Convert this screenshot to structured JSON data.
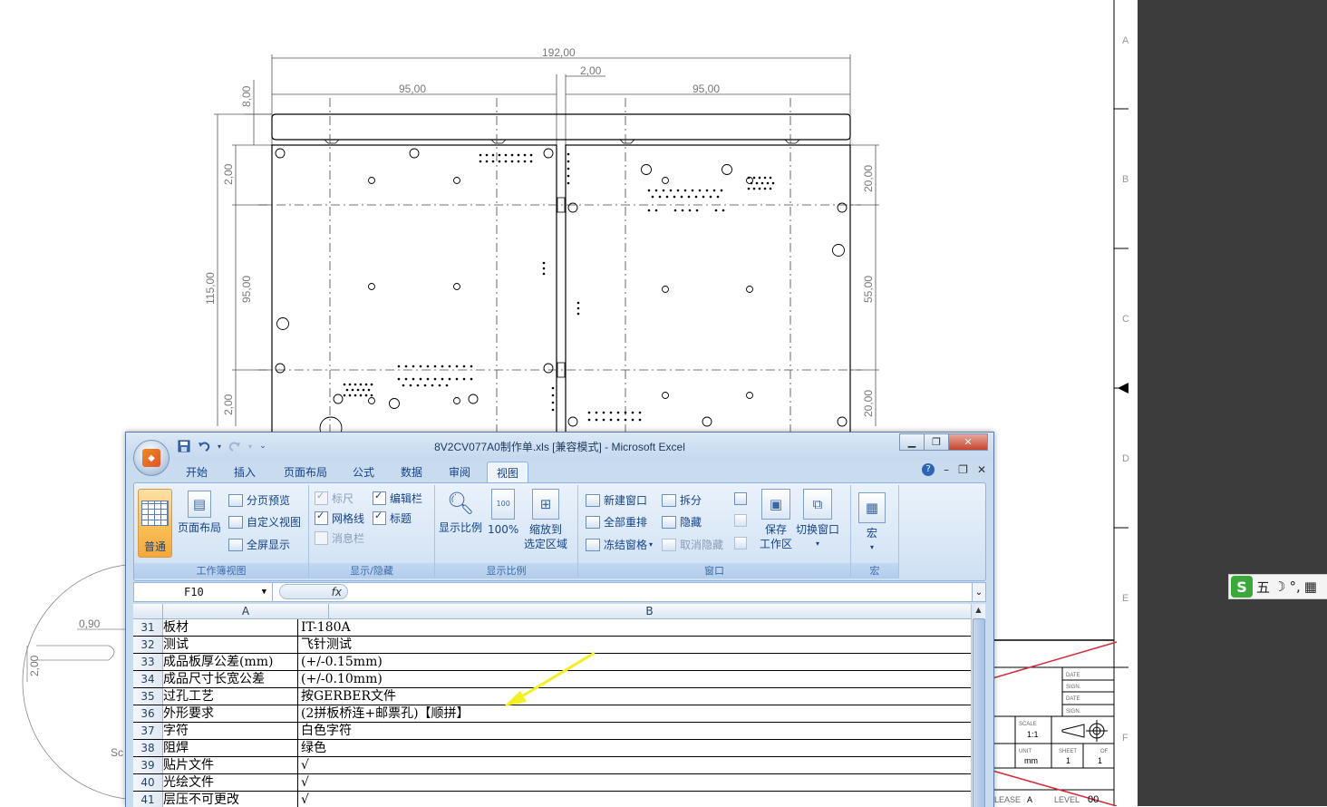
{
  "cad": {
    "dims": {
      "total_width": "192,00",
      "gap": "2,00",
      "half_left": "95,00",
      "half_right": "95,00",
      "rail_top": "8,00",
      "left_v1": "2,00",
      "left_total": "115,00",
      "left_v2": "95,00",
      "left_v3": "2,00",
      "right_v1": "20,00",
      "right_v2": "55,00",
      "right_v3": "20,00",
      "detail_a": "0,90",
      "detail_b": "2,00",
      "detail_c": "Sc"
    },
    "frame_letters": [
      "A",
      "B",
      "C",
      "D",
      "E",
      "F"
    ],
    "title_block": {
      "date1": "DATE",
      "sign1": "SIGN.",
      "date2": "DATE",
      "sign2": "SIGN.",
      "scale_label": "SCALE",
      "scale_value": "1:1",
      "unit_label": "UNIT",
      "unit_value": "mm",
      "sheet_label": "SHEET",
      "sheet_value": "1",
      "of_label": "OF",
      "of_value": "1",
      "release_label": "LEASE",
      "release_value": "A",
      "level_label": "LEVEL",
      "level_value": "00"
    }
  },
  "ime": {
    "logo": "S",
    "chars": [
      "五",
      "☽",
      "°,",
      "▦"
    ]
  },
  "excel": {
    "title": "8V2CV077A0制作单.xls  [兼容模式] - Microsoft Excel",
    "tabs": [
      "开始",
      "插入",
      "页面布局",
      "公式",
      "数据",
      "审阅",
      "视图"
    ],
    "active_tab": "视图",
    "ribbon": {
      "workbook_views": {
        "label": "工作簿视图",
        "normal": "普通",
        "page_layout": "页面布局",
        "page_break": "分页预览",
        "custom_view": "自定义视图",
        "full_screen": "全屏显示"
      },
      "show_hide": {
        "label": "显示/隐藏",
        "ruler": "标尺",
        "gridlines": "网格线",
        "message_bar": "消息栏",
        "formula_bar": "编辑栏",
        "headings": "标题"
      },
      "zoom": {
        "label": "显示比例",
        "zoom": "显示比例",
        "hundred": "100%",
        "zoom_sel_1": "缩放到",
        "zoom_sel_2": "选定区域"
      },
      "window": {
        "label": "窗口",
        "new_window": "新建窗口",
        "arrange_all": "全部重排",
        "freeze": "冻结窗格",
        "split": "拆分",
        "hide": "隐藏",
        "unhide": "取消隐藏",
        "save_ws_1": "保存",
        "save_ws_2": "工作区",
        "switch": "切换窗口"
      },
      "macros": {
        "label": "宏",
        "macro": "宏"
      }
    },
    "name_box": "F10",
    "fx": "fx",
    "columns": [
      "A",
      "B"
    ],
    "rows": [
      {
        "n": "31",
        "a": "板材",
        "b": "IT-180A"
      },
      {
        "n": "32",
        "a": "测试",
        "b": "飞针测试"
      },
      {
        "n": "33",
        "a": "成品板厚公差(mm)",
        "b": "(+/-0.15mm)"
      },
      {
        "n": "34",
        "a": "成品尺寸长宽公差",
        "b": "(+/-0.10mm)"
      },
      {
        "n": "35",
        "a": "过孔工艺",
        "b": "按GERBER文件"
      },
      {
        "n": "36",
        "a": "外形要求",
        "b": "(2拼板桥连+邮票孔)【顺拼】"
      },
      {
        "n": "37",
        "a": "字符",
        "b": "白色字符"
      },
      {
        "n": "38",
        "a": "阻焊",
        "b": "绿色"
      },
      {
        "n": "39",
        "a": "贴片文件",
        "b": "√"
      },
      {
        "n": "40",
        "a": "光绘文件",
        "b": "√"
      },
      {
        "n": "41",
        "a": "层压不可更改",
        "b": "√"
      }
    ]
  },
  "colors": {
    "annotation_arrow": "#f3f11c",
    "title_block_cross": "#d42a3c",
    "ribbon_bg": "#d5e4f5",
    "ime_logo": "#3aa83a"
  }
}
